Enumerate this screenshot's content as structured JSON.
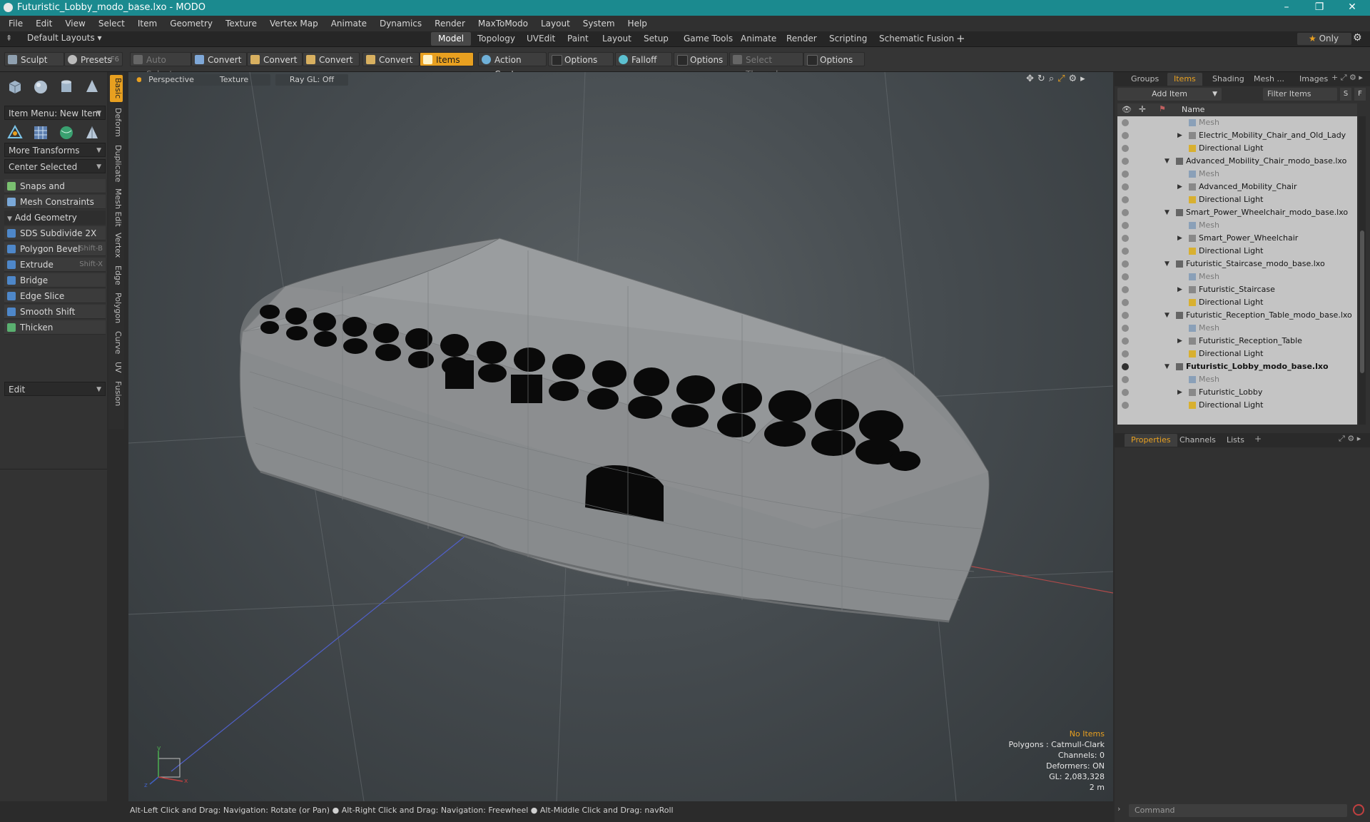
{
  "window": {
    "title": "Futuristic_Lobby_modo_base.lxo - MODO",
    "minimize": "–",
    "restore": "❐",
    "close": "✕"
  },
  "menu": [
    "File",
    "Edit",
    "View",
    "Select",
    "Item",
    "Geometry",
    "Texture",
    "Vertex Map",
    "Animate",
    "Dynamics",
    "Render",
    "MaxToModo",
    "Layout",
    "System",
    "Help"
  ],
  "layout_bar": {
    "layouts_label": "Default Layouts",
    "tabs": [
      "Model",
      "Topology",
      "UVEdit",
      "Paint",
      "Layout",
      "Setup",
      "Game Tools",
      "Animate",
      "Render",
      "Scripting",
      "Schematic Fusion"
    ],
    "add": "+",
    "only_label": "Only"
  },
  "toolbar": {
    "sculpt": "Sculpt",
    "presets": "Presets",
    "presets_shortcut": "F6",
    "auto_select": "Auto Select",
    "convert1": "Convert",
    "convert2": "Convert",
    "convert3": "Convert",
    "convert4": "Convert",
    "items": "Items",
    "action_center": "Action Center",
    "options1": "Options",
    "falloff": "Falloff",
    "options2": "Options",
    "select_through": "Select Through",
    "options3": "Options"
  },
  "left_tabs": [
    "Basic",
    "Deform",
    "Duplicate",
    "Mesh Edit",
    "Vertex",
    "Edge",
    "Polygon",
    "Curve",
    "UV",
    "Fusion"
  ],
  "left_panel": {
    "item_menu": "Item Menu: New Item",
    "more_transforms": "More Transforms",
    "center_selected": "Center Selected",
    "snaps": "Snaps and Precision",
    "mesh_constraints": "Mesh Constraints",
    "add_geometry": "Add Geometry",
    "tools": [
      {
        "label": "SDS Subdivide 2X",
        "shortcut": ""
      },
      {
        "label": "Polygon Bevel",
        "shortcut": "Shift-B"
      },
      {
        "label": "Extrude",
        "shortcut": "Shift-X"
      },
      {
        "label": "Bridge",
        "shortcut": ""
      },
      {
        "label": "Edge Slice",
        "shortcut": ""
      },
      {
        "label": "Smooth Shift",
        "shortcut": ""
      },
      {
        "label": "Thicken",
        "shortcut": ""
      }
    ],
    "edit": "Edit"
  },
  "viewport": {
    "view_mode": "Perspective",
    "shading": "Texture",
    "raygl": "Ray GL: Off",
    "info": {
      "selection": "No Items",
      "polygons": "Polygons : Catmull-Clark",
      "channels": "Channels: 0",
      "deformers": "Deformers: ON",
      "gl": "GL: 2,083,328",
      "scale": "2 m"
    }
  },
  "status_bar": "Alt-Left Click and Drag: Navigation: Rotate (or Pan) ● Alt-Right Click and Drag: Navigation: Freewheel ● Alt-Middle Click and Drag: navRoll",
  "right_panel": {
    "top_tabs": [
      "Groups",
      "Items",
      "Shading",
      "Mesh ...",
      "Images"
    ],
    "add_item": "Add Item",
    "filter_items": "Filter Items",
    "s_btn": "S",
    "f_btn": "F",
    "name_header": "Name",
    "tree": [
      {
        "label": "Mesh",
        "level": 2,
        "kind": "mesh",
        "dim": true
      },
      {
        "label": "Electric_Mobility_Chair_and_Old_Lady",
        "level": 2,
        "kind": "group",
        "expander": "▶"
      },
      {
        "label": "Directional Light",
        "level": 2,
        "kind": "light"
      },
      {
        "label": "Advanced_Mobility_Chair_modo_base.lxo",
        "level": 1,
        "kind": "scene",
        "expander": "▼"
      },
      {
        "label": "Mesh",
        "level": 2,
        "kind": "mesh",
        "dim": true
      },
      {
        "label": "Advanced_Mobility_Chair",
        "level": 2,
        "kind": "group",
        "expander": "▶"
      },
      {
        "label": "Directional Light",
        "level": 2,
        "kind": "light"
      },
      {
        "label": "Smart_Power_Wheelchair_modo_base.lxo",
        "level": 1,
        "kind": "scene",
        "expander": "▼"
      },
      {
        "label": "Mesh",
        "level": 2,
        "kind": "mesh",
        "dim": true
      },
      {
        "label": "Smart_Power_Wheelchair",
        "level": 2,
        "kind": "group",
        "expander": "▶"
      },
      {
        "label": "Directional Light",
        "level": 2,
        "kind": "light"
      },
      {
        "label": "Futuristic_Staircase_modo_base.lxo",
        "level": 1,
        "kind": "scene",
        "expander": "▼"
      },
      {
        "label": "Mesh",
        "level": 2,
        "kind": "mesh",
        "dim": true
      },
      {
        "label": "Futuristic_Staircase",
        "level": 2,
        "kind": "group",
        "expander": "▶"
      },
      {
        "label": "Directional Light",
        "level": 2,
        "kind": "light"
      },
      {
        "label": "Futuristic_Reception_Table_modo_base.lxo",
        "level": 1,
        "kind": "scene",
        "expander": "▼"
      },
      {
        "label": "Mesh",
        "level": 2,
        "kind": "mesh",
        "dim": true
      },
      {
        "label": "Futuristic_Reception_Table",
        "level": 2,
        "kind": "group",
        "expander": "▶"
      },
      {
        "label": "Directional Light",
        "level": 2,
        "kind": "light"
      },
      {
        "label": "Futuristic_Lobby_modo_base.lxo",
        "level": 1,
        "kind": "scene",
        "expander": "▼",
        "bold": true
      },
      {
        "label": "Mesh",
        "level": 2,
        "kind": "mesh",
        "dim": true
      },
      {
        "label": "Futuristic_Lobby",
        "level": 2,
        "kind": "group",
        "expander": "▶"
      },
      {
        "label": "Directional Light",
        "level": 2,
        "kind": "light"
      }
    ],
    "bottom_tabs": [
      "Properties",
      "Channels",
      "Lists"
    ],
    "command_placeholder": "Command"
  },
  "colors": {
    "accent": "#e8a020",
    "titlebar": "#1b8a8f",
    "tree_bg": "#c4c4c4"
  }
}
